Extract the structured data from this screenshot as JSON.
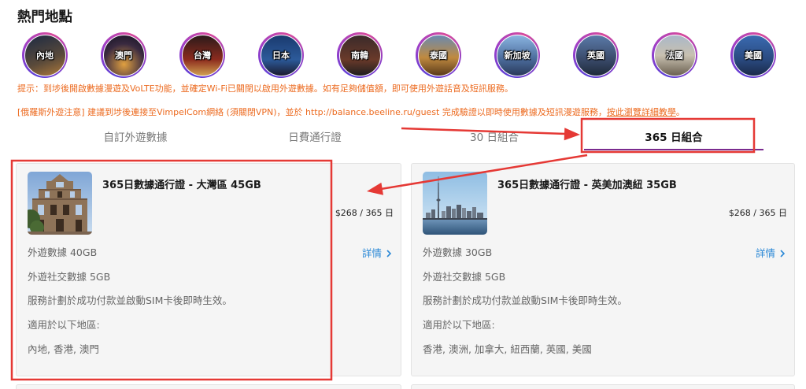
{
  "section_title": "熱門地點",
  "destinations": [
    {
      "label": "內地"
    },
    {
      "label": "澳門"
    },
    {
      "label": "台灣"
    },
    {
      "label": "日本"
    },
    {
      "label": "南韓"
    },
    {
      "label": "泰國"
    },
    {
      "label": "新加坡"
    },
    {
      "label": "英國"
    },
    {
      "label": "法國"
    },
    {
      "label": "美國"
    }
  ],
  "notices": {
    "tip": "提示：到埗後開啟數據漫遊及VoLTE功能，並確定Wi-Fi已關閉以啟用外遊數據。如有足夠儲值額，即可使用外遊話音及短訊服務。",
    "russia": {
      "prefix": "[俄羅斯外遊注意] 建議到埗後連接至VimpelCom網絡 (須關閉VPN)，並於 http://balance.beeline.ru/guest 完成驗證以即時使用數據及短訊漫遊服務，",
      "link": "按此瀏覽詳細教學",
      "suffix": "。"
    }
  },
  "tabs": [
    {
      "label": "自訂外遊數據",
      "selected": false
    },
    {
      "label": "日費通行證",
      "selected": false
    },
    {
      "label": "30 日組合",
      "selected": false
    },
    {
      "label": "365 日組合",
      "selected": true
    }
  ],
  "plans": [
    {
      "title": "365日數據通行證 - 大灣區 45GB",
      "price": "$268 / 365 日",
      "details_label": "詳情",
      "data": "外遊數據 40GB",
      "social_data": "外遊社交數據 5GB",
      "activation": "服務計劃於成功付款並啟動SIM卡後即時生效。",
      "regions_heading": "適用於以下地區:",
      "regions": "內地, 香港, 澳門"
    },
    {
      "title": "365日數據通行證 - 英美加澳紐 35GB",
      "price": "$268 / 365 日",
      "details_label": "詳情",
      "data": "外遊數據 30GB",
      "social_data": "外遊社交數據 5GB",
      "activation": "服務計劃於成功付款並啟動SIM卡後即時生效。",
      "regions_heading": "適用於以下地區:",
      "regions": "香港, 澳洲, 加拿大, 紐西蘭, 英國, 美國"
    }
  ],
  "icons": {
    "details": "chevron-right-icon"
  },
  "colors": {
    "accent": "#7a2b8f",
    "notice": "#ec6a1f",
    "link": "#2a88d6",
    "annotation": "#e53935"
  }
}
